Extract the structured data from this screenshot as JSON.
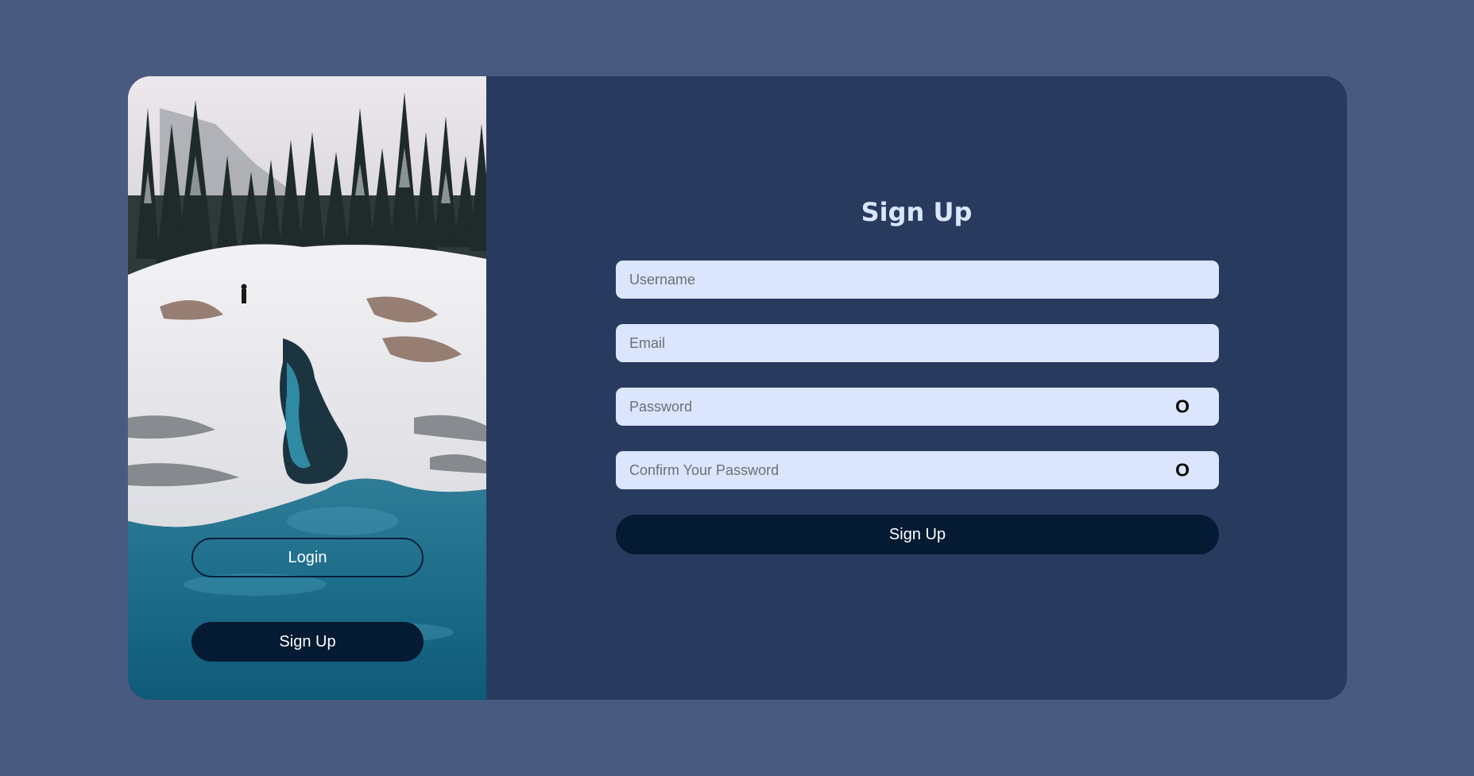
{
  "side_panel": {
    "image_description_icon": "snowy-river-landscape-photo",
    "login_label": "Login",
    "signup_label": "Sign Up"
  },
  "form": {
    "title": "Sign Up",
    "username_placeholder": "Username",
    "email_placeholder": "Email",
    "password_placeholder": "Password",
    "confirm_placeholder": "Confirm Your Password",
    "toggle_glyph": "O",
    "submit_label": "Sign Up"
  },
  "colors": {
    "page_background": "#485a80",
    "card_background": "#293a5f",
    "input_background": "#dbe5fe",
    "button_dark": "#051a33",
    "title_color": "#dbe6ff"
  }
}
